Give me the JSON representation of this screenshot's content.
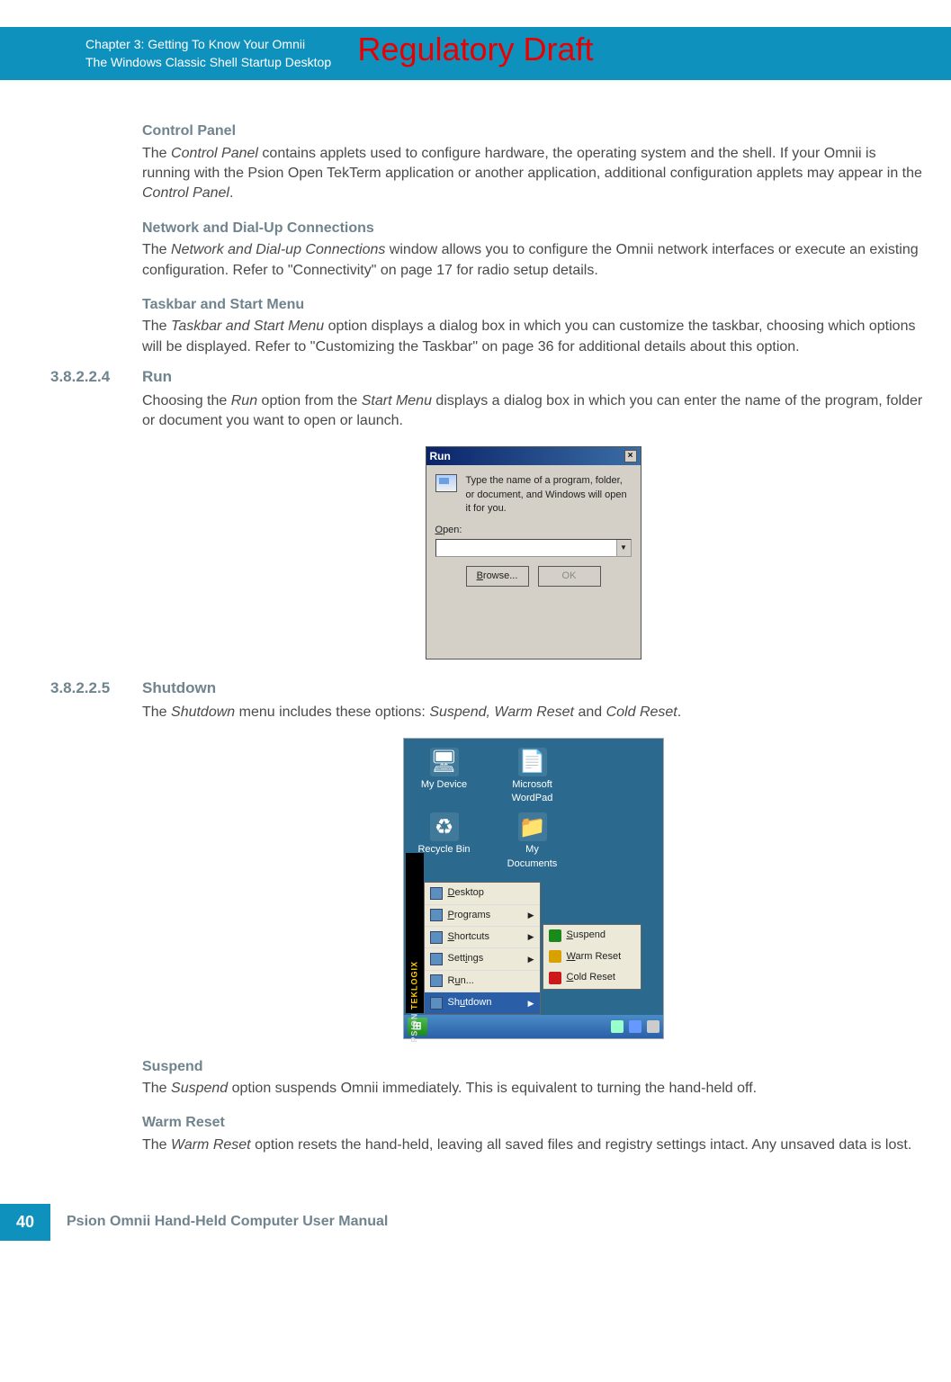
{
  "watermark": "Regulatory Draft",
  "header": {
    "chapter": "Chapter 3:  Getting To Know Your Omnii",
    "section": "The Windows Classic Shell Startup Desktop"
  },
  "sections": {
    "control_panel": {
      "heading": "Control Panel",
      "p1a": "The ",
      "p1i": "Control Panel",
      "p1b": " contains applets used to configure hardware, the operating system and the shell. If your Omnii is running with the Psion Open TekTerm application or another application, additional configuration applets may appear in the ",
      "p1i2": "Control Panel",
      "p1c": "."
    },
    "network": {
      "heading": "Network and Dial-Up Connections",
      "p1a": "The ",
      "p1i": "Network and Dial-up Connections",
      "p1b": " window allows you to configure the Omnii network interfaces or execute an existing configuration. Refer to \"Connectivity\" on page 17 for radio setup details."
    },
    "taskbar": {
      "heading": "Taskbar and Start Menu",
      "p1a": "The ",
      "p1i": "Taskbar and Start Menu",
      "p1b": " option displays a dialog box in which you can customize the taskbar, choosing which options will be displayed. Refer to \"Customizing the Taskbar\" on page 36 for additional details about this option."
    },
    "run": {
      "num": "3.8.2.2.4",
      "title": "Run",
      "p1a": "Choosing the ",
      "p1i": "Run",
      "p1b": " option from the ",
      "p1i2": "Start Menu",
      "p1c": " displays a dialog box in which you can enter the name of the program, folder or document you want to open or launch."
    },
    "shutdown": {
      "num": "3.8.2.2.5",
      "title": "Shutdown",
      "p1a": "The ",
      "p1i": "Shutdown",
      "p1b": " menu includes these options: ",
      "p1i2": "Suspend, Warm Reset",
      "p1c": " and ",
      "p1i3": "Cold Reset",
      "p1d": "."
    },
    "suspend": {
      "heading": "Suspend",
      "p1a": "The ",
      "p1i": "Suspend",
      "p1b": " option suspends Omnii immediately. This is equivalent to turning the hand-held off."
    },
    "warm_reset": {
      "heading": "Warm Reset",
      "p1a": "The ",
      "p1i": "Warm Reset",
      "p1b": " option resets the hand-held, leaving all saved files and registry settings intact. Any unsaved data is lost."
    }
  },
  "run_dialog": {
    "title": "Run",
    "close": "×",
    "desc": "Type the name of a program, folder, or document, and Windows will open it for you.",
    "open_u": "O",
    "open_rest": "pen:",
    "browse_u": "B",
    "browse_rest": "rowse...",
    "ok": "OK"
  },
  "desktop": {
    "icons": {
      "my_device": "My Device",
      "wordpad": "Microsoft WordPad",
      "recycle": "Recycle Bin",
      "my_docs": "My Documents"
    }
  },
  "start_menu": {
    "strip_brand": "PSION",
    "strip_brand2": "TEKLOGIX",
    "items": {
      "desktop_u": "D",
      "desktop_rest": "esktop",
      "programs_u": "P",
      "programs_rest": "rograms",
      "shortcuts_u": "S",
      "shortcuts_rest": "hortcuts",
      "settings": "Settings",
      "settings_u": "i",
      "settings_pre": "Sett",
      "settings_post": "ngs",
      "run_u": "u",
      "run_pre": "R",
      "run_post": "n...",
      "shutdown_u": "u",
      "shutdown_pre": "Sh",
      "shutdown_post": "tdown"
    },
    "submenu": {
      "suspend_u": "S",
      "suspend_rest": "uspend",
      "warm_u": "W",
      "warm_rest": "arm Reset",
      "cold_u": "C",
      "cold_rest": "old Reset"
    }
  },
  "footer": {
    "page": "40",
    "manual": "Psion Omnii Hand-Held Computer User Manual"
  }
}
